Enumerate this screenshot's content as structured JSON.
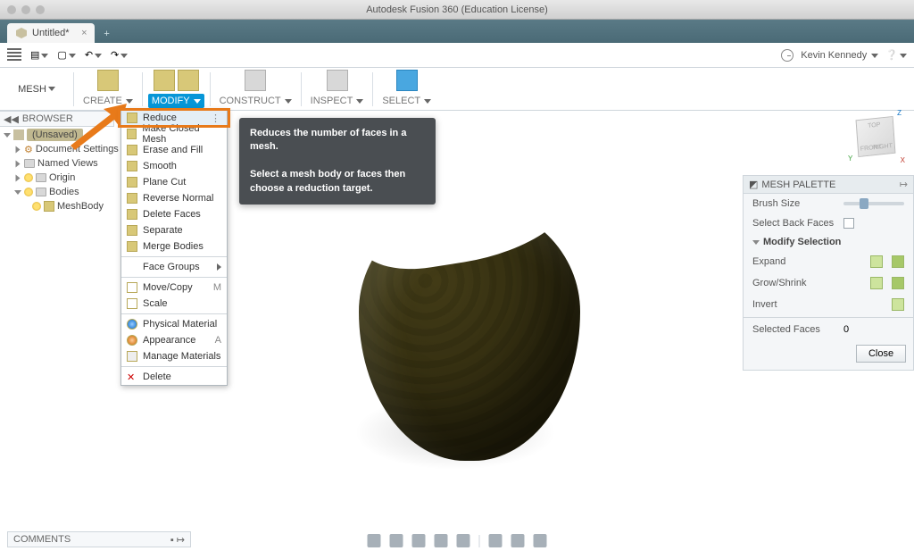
{
  "window": {
    "title": "Autodesk Fusion 360 (Education License)"
  },
  "tab": {
    "title": "Untitled*"
  },
  "user": {
    "name": "Kevin Kennedy"
  },
  "workspace": {
    "label": "MESH"
  },
  "ribbon": {
    "create": "CREATE",
    "modify": "MODIFY",
    "construct": "CONSTRUCT",
    "inspect": "INSPECT",
    "select": "SELECT"
  },
  "browser": {
    "header": "BROWSER",
    "root": "(Unsaved)",
    "items": [
      "Document Settings",
      "Named Views",
      "Origin",
      "Bodies"
    ],
    "body_item": "MeshBody"
  },
  "dropdown": {
    "items": [
      "Reduce",
      "Make Closed Mesh",
      "Erase and Fill",
      "Smooth",
      "Plane Cut",
      "Reverse Normal",
      "Delete Faces",
      "Separate",
      "Merge Bodies",
      "Face Groups",
      "Move/Copy",
      "Scale",
      "Physical Material",
      "Appearance",
      "Manage Materials",
      "Delete"
    ],
    "shortcuts": {
      "move": "M",
      "appearance": "A"
    }
  },
  "tooltip": {
    "line1": "Reduces the number of faces in a mesh.",
    "line2": "Select a mesh body or faces then choose a reduction target."
  },
  "viewcube": {
    "top": "TOP",
    "front": "FRONT",
    "right": "RIGHT"
  },
  "palette": {
    "title": "MESH PALETTE",
    "brush": "Brush Size",
    "backfaces": "Select Back Faces",
    "section": "Modify Selection",
    "expand": "Expand",
    "growshrink": "Grow/Shrink",
    "invert": "Invert",
    "selfaces_lbl": "Selected Faces",
    "selfaces_val": "0",
    "close": "Close"
  },
  "comments": {
    "label": "COMMENTS"
  }
}
